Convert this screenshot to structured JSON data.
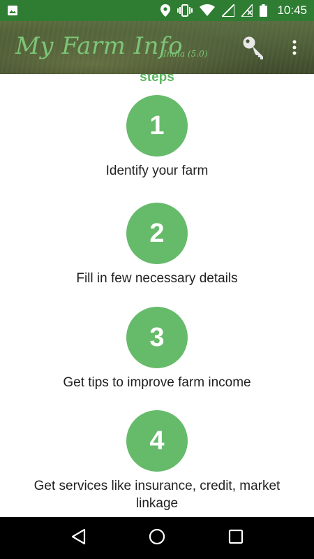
{
  "status_bar": {
    "time": "10:45",
    "icons": [
      "image-icon",
      "location-icon",
      "vibrate-icon",
      "wifi-icon",
      "signal-icon",
      "no-sim-icon",
      "battery-icon"
    ]
  },
  "app_bar": {
    "title": "My Farm Info",
    "subtitle": "India (5.0)",
    "actions": [
      "key-icon",
      "more-vert-icon"
    ]
  },
  "content": {
    "heading": "steps",
    "steps": [
      {
        "number": "1",
        "label": "Identify your farm"
      },
      {
        "number": "2",
        "label": "Fill in few necessary details"
      },
      {
        "number": "3",
        "label": "Get tips to improve farm income"
      },
      {
        "number": "4",
        "label": "Get services like insurance, credit, market linkage"
      }
    ]
  },
  "nav_bar": {
    "buttons": [
      "back-icon",
      "home-icon",
      "recents-icon"
    ]
  },
  "colors": {
    "status_bar": "#2e7d32",
    "accent_green": "#66bb6a",
    "title_green": "#7cc576",
    "text": "#1f1f1f"
  }
}
